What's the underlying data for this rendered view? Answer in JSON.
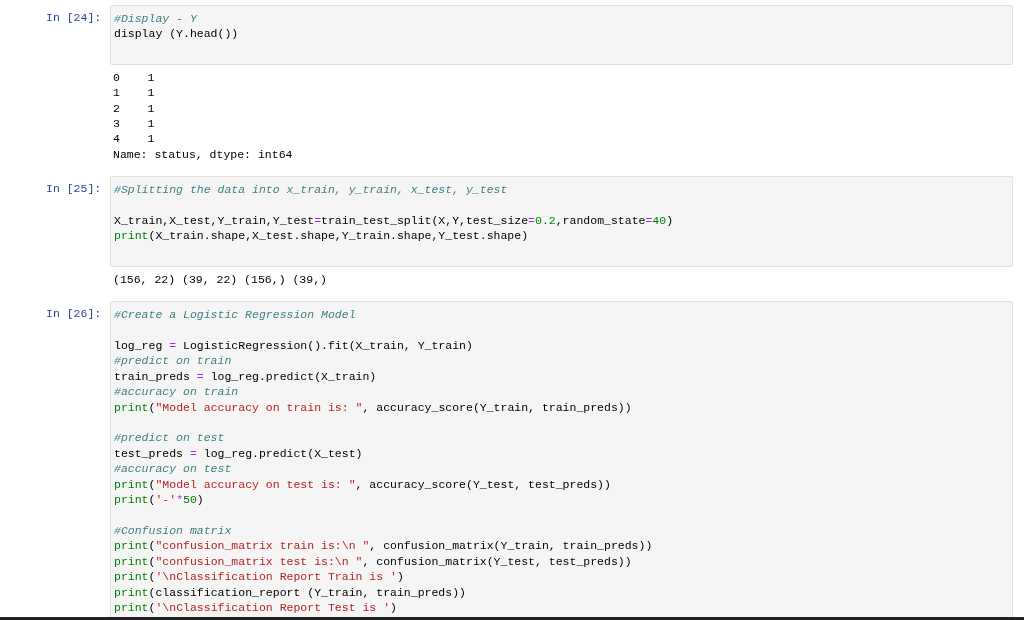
{
  "cells": [
    {
      "prompt": "In [24]:",
      "code": [
        {
          "kind": "code",
          "tokens": [
            {
              "kind": "comment",
              "text": "#Display - Y"
            }
          ]
        },
        {
          "kind": "code",
          "tokens": [
            {
              "kind": "text",
              "text": "display (Y.head())"
            }
          ]
        }
      ],
      "output": [
        "0    1",
        "1    1",
        "2    1",
        "3    1",
        "4    1",
        "Name: status, dtype: int64"
      ]
    },
    {
      "prompt": "In [25]:",
      "code": [
        {
          "kind": "code",
          "tokens": [
            {
              "kind": "comment",
              "text": "#Splitting the data into x_train, y_train, x_test, y_test"
            }
          ]
        },
        {
          "kind": "blank"
        },
        {
          "kind": "code",
          "tokens": [
            {
              "kind": "text",
              "text": "X_train,X_test,Y_train,Y_test"
            },
            {
              "kind": "operator",
              "text": "="
            },
            {
              "kind": "text",
              "text": "train_test_split(X,Y,test_size"
            },
            {
              "kind": "operator",
              "text": "="
            },
            {
              "kind": "number",
              "text": "0.2"
            },
            {
              "kind": "text",
              "text": ",random_state"
            },
            {
              "kind": "operator",
              "text": "="
            },
            {
              "kind": "number",
              "text": "40"
            },
            {
              "kind": "text",
              "text": ")"
            }
          ]
        },
        {
          "kind": "code",
          "tokens": [
            {
              "kind": "builtin",
              "text": "print"
            },
            {
              "kind": "text",
              "text": "(X_train.shape,X_test.shape,Y_train.shape,Y_test.shape)"
            }
          ]
        }
      ],
      "output": [
        "(156, 22) (39, 22) (156,) (39,)"
      ]
    },
    {
      "prompt": "In [26]:",
      "code": [
        {
          "kind": "code",
          "tokens": [
            {
              "kind": "comment",
              "text": "#Create a Logistic Regression Model"
            }
          ]
        },
        {
          "kind": "blank"
        },
        {
          "kind": "code",
          "tokens": [
            {
              "kind": "text",
              "text": "log_reg "
            },
            {
              "kind": "operator",
              "text": "="
            },
            {
              "kind": "text",
              "text": " LogisticRegression().fit(X_train, Y_train)"
            }
          ]
        },
        {
          "kind": "code",
          "tokens": [
            {
              "kind": "comment",
              "text": "#predict on train"
            }
          ]
        },
        {
          "kind": "code",
          "tokens": [
            {
              "kind": "text",
              "text": "train_preds "
            },
            {
              "kind": "operator",
              "text": "="
            },
            {
              "kind": "text",
              "text": " log_reg.predict(X_train)"
            }
          ]
        },
        {
          "kind": "code",
          "tokens": [
            {
              "kind": "comment",
              "text": "#accuracy on train"
            }
          ]
        },
        {
          "kind": "code",
          "tokens": [
            {
              "kind": "builtin",
              "text": "print"
            },
            {
              "kind": "text",
              "text": "("
            },
            {
              "kind": "string",
              "text": "\"Model accuracy on train is: \""
            },
            {
              "kind": "text",
              "text": ", accuracy_score(Y_train, train_preds))"
            }
          ]
        },
        {
          "kind": "blank"
        },
        {
          "kind": "code",
          "tokens": [
            {
              "kind": "comment",
              "text": "#predict on test"
            }
          ]
        },
        {
          "kind": "code",
          "tokens": [
            {
              "kind": "text",
              "text": "test_preds "
            },
            {
              "kind": "operator",
              "text": "="
            },
            {
              "kind": "text",
              "text": " log_reg.predict(X_test)"
            }
          ]
        },
        {
          "kind": "code",
          "tokens": [
            {
              "kind": "comment",
              "text": "#accuracy on test"
            }
          ]
        },
        {
          "kind": "code",
          "tokens": [
            {
              "kind": "builtin",
              "text": "print"
            },
            {
              "kind": "text",
              "text": "("
            },
            {
              "kind": "string",
              "text": "\"Model accuracy on test is: \""
            },
            {
              "kind": "text",
              "text": ", accuracy_score(Y_test, test_preds))"
            }
          ]
        },
        {
          "kind": "code",
          "tokens": [
            {
              "kind": "builtin",
              "text": "print"
            },
            {
              "kind": "text",
              "text": "("
            },
            {
              "kind": "string",
              "text": "'-'"
            },
            {
              "kind": "operator",
              "text": "*"
            },
            {
              "kind": "number",
              "text": "50"
            },
            {
              "kind": "text",
              "text": ")"
            }
          ]
        },
        {
          "kind": "blank"
        },
        {
          "kind": "code",
          "tokens": [
            {
              "kind": "comment",
              "text": "#Confusion matrix"
            }
          ]
        },
        {
          "kind": "code",
          "tokens": [
            {
              "kind": "builtin",
              "text": "print"
            },
            {
              "kind": "text",
              "text": "("
            },
            {
              "kind": "string",
              "text": "\"confusion_matrix train is:\\n \""
            },
            {
              "kind": "text",
              "text": ", confusion_matrix(Y_train, train_preds))"
            }
          ]
        },
        {
          "kind": "code",
          "tokens": [
            {
              "kind": "builtin",
              "text": "print"
            },
            {
              "kind": "text",
              "text": "("
            },
            {
              "kind": "string",
              "text": "\"confusion_matrix test is:\\n \""
            },
            {
              "kind": "text",
              "text": ", confusion_matrix(Y_test, test_preds))"
            }
          ]
        },
        {
          "kind": "code",
          "tokens": [
            {
              "kind": "builtin",
              "text": "print"
            },
            {
              "kind": "text",
              "text": "("
            },
            {
              "kind": "string",
              "text": "'\\nClassification Report Train is '"
            },
            {
              "kind": "text",
              "text": ")"
            }
          ]
        },
        {
          "kind": "code",
          "tokens": [
            {
              "kind": "builtin",
              "text": "print"
            },
            {
              "kind": "text",
              "text": "(classification_report (Y_train, train_preds))"
            }
          ]
        },
        {
          "kind": "code",
          "tokens": [
            {
              "kind": "builtin",
              "text": "print"
            },
            {
              "kind": "text",
              "text": "("
            },
            {
              "kind": "string",
              "text": "'\\nClassification Report Test is '"
            },
            {
              "kind": "text",
              "text": ")"
            }
          ]
        }
      ]
    }
  ]
}
